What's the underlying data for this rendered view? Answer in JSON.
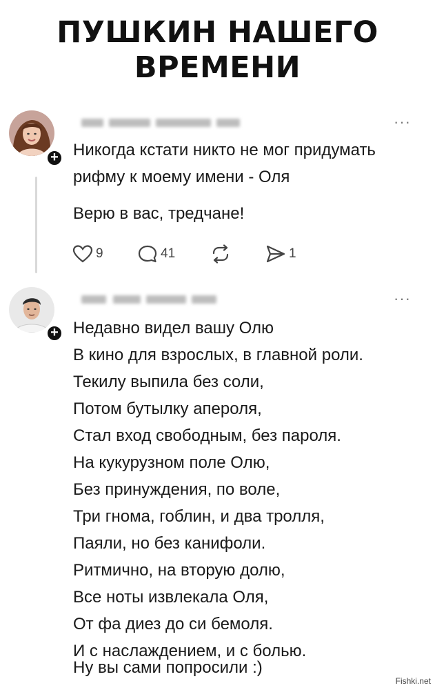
{
  "title": {
    "line1": "ПУШКИН НАШЕГО",
    "line2": "ВРЕМЕНИ"
  },
  "post1": {
    "username_visible": false,
    "more_label": "···",
    "lines": [
      "Никогда кстати никто не мог придумать",
      "рифму к моему имени - Оля"
    ],
    "extra": "Верю в вас, тредчане!",
    "likes": "9",
    "comments": "41",
    "reposts": "",
    "shares": "1"
  },
  "post2": {
    "username_visible": false,
    "more_label": "···",
    "lines": [
      "Недавно видел вашу Олю",
      "В кино для взрослых, в главной роли.",
      "Текилу выпила без соли,",
      "Потом бутылку апероля,",
      "Стал вход свободным, без пароля.",
      "На кукурузном поле Олю,",
      "Без принуждения, по воле,",
      "Три гнома, гоблин, и два тролля,",
      "Паяли, но без канифоли.",
      "Ритмично, на вторую долю,",
      "Все ноты извлекала Оля,",
      "От фа диез до си бемоля.",
      "И с наслаждением, и с болью."
    ],
    "extra": "Ну вы сами попросили :)"
  },
  "icons": {
    "like": "heart-icon",
    "comment": "comment-bubble-icon",
    "repost": "repost-arrows-icon",
    "share": "send-icon",
    "follow": "plus-icon"
  },
  "watermark": "Fishki.net"
}
